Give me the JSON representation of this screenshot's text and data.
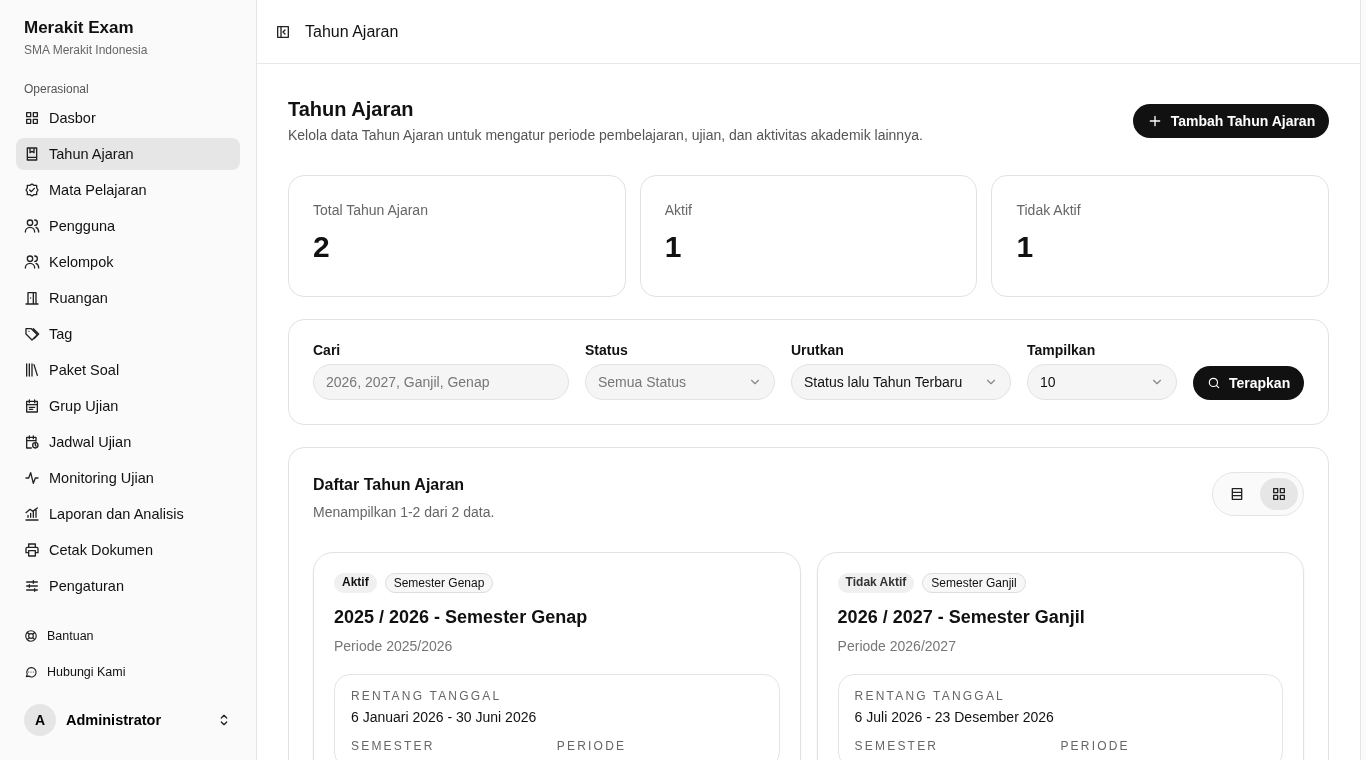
{
  "sidebar": {
    "app_name": "Merakit Exam",
    "school": "SMA Merakit Indonesia",
    "section": "Operasional",
    "items": [
      {
        "label": "Dasbor",
        "selected": false
      },
      {
        "label": "Tahun Ajaran",
        "selected": true
      },
      {
        "label": "Mata Pelajaran",
        "selected": false
      },
      {
        "label": "Pengguna",
        "selected": false
      },
      {
        "label": "Kelompok",
        "selected": false
      },
      {
        "label": "Ruangan",
        "selected": false
      },
      {
        "label": "Tag",
        "selected": false
      },
      {
        "label": "Paket Soal",
        "selected": false
      },
      {
        "label": "Grup Ujian",
        "selected": false
      },
      {
        "label": "Jadwal Ujian",
        "selected": false
      },
      {
        "label": "Monitoring Ujian",
        "selected": false
      },
      {
        "label": "Laporan dan Analisis",
        "selected": false
      },
      {
        "label": "Cetak Dokumen",
        "selected": false
      },
      {
        "label": "Pengaturan",
        "selected": false
      }
    ],
    "footer_links": [
      "Bantuan",
      "Hubungi Kami"
    ],
    "user": {
      "initial": "A",
      "name": "Administrator"
    }
  },
  "header": {
    "title": "Tahun Ajaran"
  },
  "page": {
    "title": "Tahun Ajaran",
    "subtitle": "Kelola data Tahun Ajaran untuk mengatur periode pembelajaran, ujian, dan aktivitas akademik lainnya.",
    "add_button": "Tambah Tahun Ajaran"
  },
  "stats": [
    {
      "label": "Total Tahun Ajaran",
      "value": "2"
    },
    {
      "label": "Aktif",
      "value": "1"
    },
    {
      "label": "Tidak Aktif",
      "value": "1"
    }
  ],
  "filters": {
    "search": {
      "label": "Cari",
      "placeholder": "2026, 2027, Ganjil, Genap"
    },
    "selects": [
      {
        "label": "Status",
        "placeholder": "Semua Status"
      },
      {
        "label": "Urutkan",
        "value": "Status lalu Tahun Terbaru"
      },
      {
        "label": "Tampilkan",
        "value": "10"
      }
    ],
    "apply_button": "Terapkan"
  },
  "list": {
    "title": "Daftar Tahun Ajaran",
    "summary": "Menampilkan 1-2 dari 2 data.",
    "view_toggle": [
      {
        "kind": "list",
        "selected": false
      },
      {
        "kind": "grid",
        "selected": true
      }
    ],
    "cards": [
      {
        "status": "Aktif",
        "active": true,
        "semester_tag": "Semester Genap",
        "title": "2025 / 2026 - Semester Genap",
        "period": "Periode 2025/2026",
        "range_label": "RENTANG TANGGAL",
        "range": "6 Januari 2026 - 30 Juni 2026",
        "col_labels": [
          "SEMESTER",
          "PERIODE"
        ]
      },
      {
        "status": "Tidak Aktif",
        "active": false,
        "semester_tag": "Semester Ganjil",
        "title": "2026 / 2027 - Semester Ganjil",
        "period": "Periode 2026/2027",
        "range_label": "RENTANG TANGGAL",
        "range": "6 Juli 2026 - 23 Desember 2026",
        "col_labels": [
          "SEMESTER",
          "PERIODE"
        ]
      }
    ]
  }
}
